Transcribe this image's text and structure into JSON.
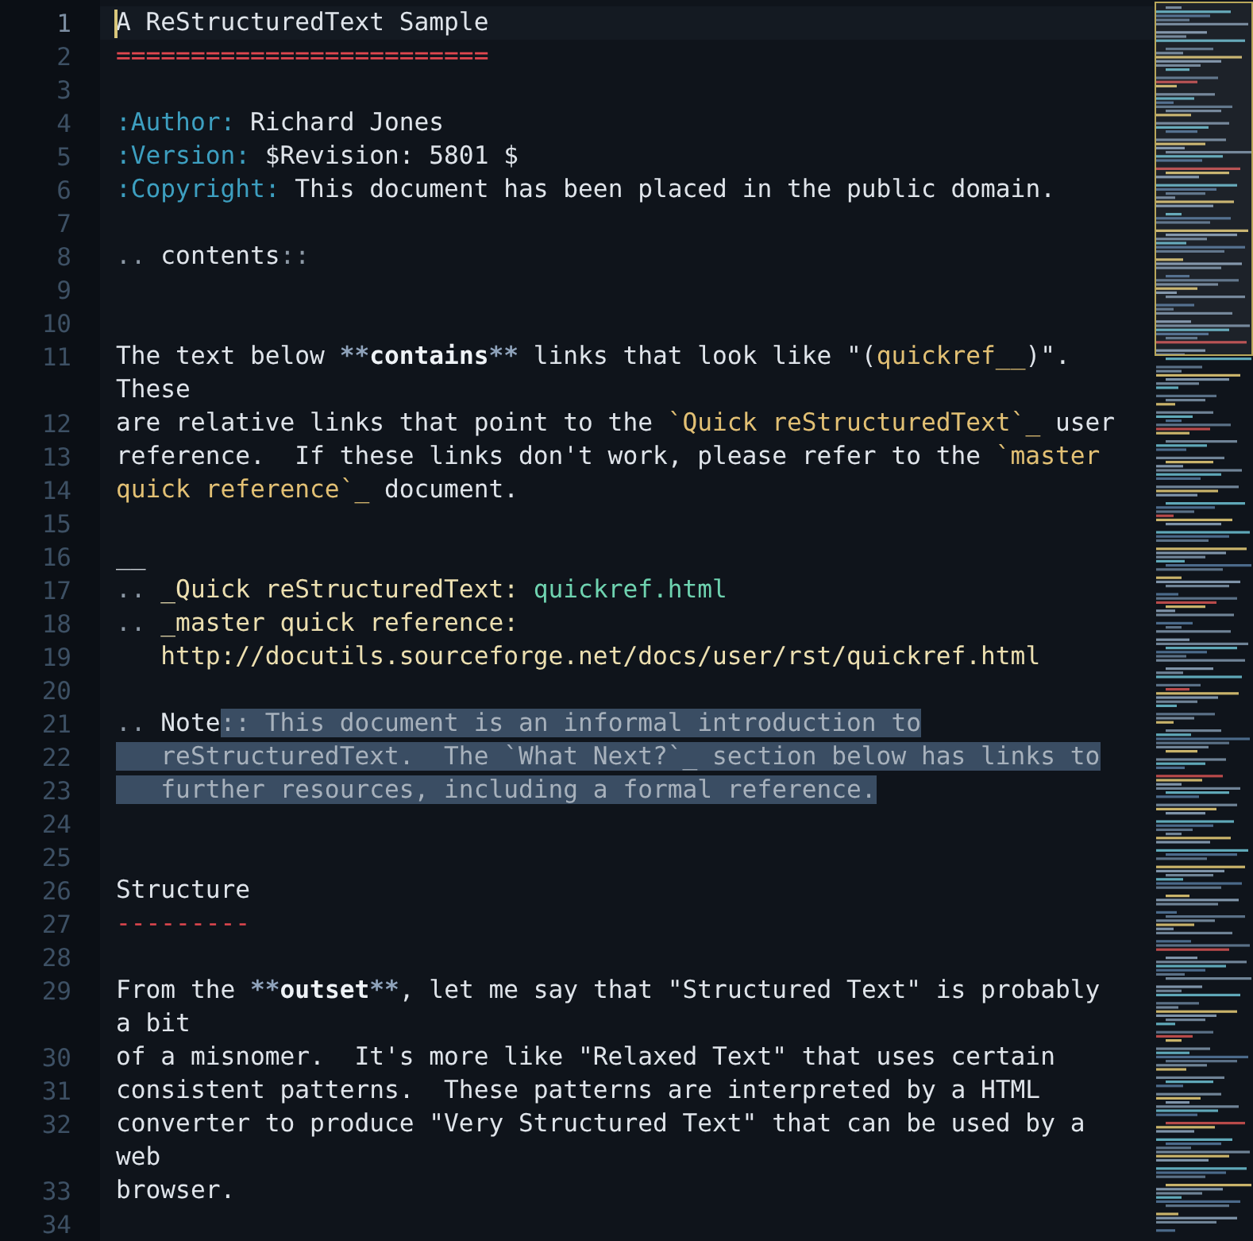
{
  "editor": {
    "lines": [
      {
        "number": "1",
        "current": true,
        "rows": [
          [
            {
              "kind": "plain",
              "text": "A ReStructuredText Sample"
            }
          ]
        ]
      },
      {
        "number": "2",
        "rows": [
          [
            {
              "kind": "underline",
              "text": "========================="
            }
          ]
        ]
      },
      {
        "number": "3",
        "rows": [
          []
        ]
      },
      {
        "number": "4",
        "rows": [
          [
            {
              "kind": "field",
              "text": ":Author:"
            },
            {
              "kind": "plain",
              "text": " Richard Jones"
            }
          ]
        ]
      },
      {
        "number": "5",
        "rows": [
          [
            {
              "kind": "field",
              "text": ":Version:"
            },
            {
              "kind": "plain",
              "text": " $Revision: 5801 $"
            }
          ]
        ]
      },
      {
        "number": "6",
        "rows": [
          [
            {
              "kind": "field",
              "text": ":Copyright:"
            },
            {
              "kind": "plain",
              "text": " This document has been placed in the public domain."
            }
          ]
        ]
      },
      {
        "number": "7",
        "rows": [
          []
        ]
      },
      {
        "number": "8",
        "rows": [
          [
            {
              "kind": "punct",
              "text": ".."
            },
            {
              "kind": "plain",
              "text": " contents"
            },
            {
              "kind": "punct",
              "text": "::"
            }
          ]
        ]
      },
      {
        "number": "9",
        "rows": [
          []
        ]
      },
      {
        "number": "10",
        "rows": [
          []
        ]
      },
      {
        "number": "11",
        "rows": [
          [
            {
              "kind": "plain",
              "text": "The text below "
            },
            {
              "kind": "marker",
              "text": "**"
            },
            {
              "kind": "strong",
              "text": "contains"
            },
            {
              "kind": "marker",
              "text": "**"
            },
            {
              "kind": "plain",
              "text": " links that look like \"("
            },
            {
              "kind": "ref",
              "text": "quickref__"
            },
            {
              "kind": "plain",
              "text": ")\"."
            }
          ],
          [
            {
              "kind": "plain",
              "text": "These"
            }
          ]
        ]
      },
      {
        "number": "12",
        "rows": [
          [
            {
              "kind": "plain",
              "text": "are relative links that point to the "
            },
            {
              "kind": "ref",
              "text": "`Quick reStructuredText`_"
            },
            {
              "kind": "plain",
              "text": " user"
            }
          ]
        ]
      },
      {
        "number": "13",
        "rows": [
          [
            {
              "kind": "plain",
              "text": "reference.  If these links don't work, please refer to the "
            },
            {
              "kind": "ref",
              "text": "`master"
            }
          ]
        ]
      },
      {
        "number": "14",
        "rows": [
          [
            {
              "kind": "ref",
              "text": "quick reference`_"
            },
            {
              "kind": "plain",
              "text": " document."
            }
          ]
        ]
      },
      {
        "number": "15",
        "rows": [
          []
        ]
      },
      {
        "number": "16",
        "rows": [
          [
            {
              "kind": "plain",
              "text": "__"
            }
          ]
        ]
      },
      {
        "number": "17",
        "rows": [
          [
            {
              "kind": "punct",
              "text": ".."
            },
            {
              "kind": "plain",
              "text": " "
            },
            {
              "kind": "target",
              "text": "_Quick reStructuredText:"
            },
            {
              "kind": "plain",
              "text": " "
            },
            {
              "kind": "url",
              "text": "quickref.html"
            }
          ]
        ]
      },
      {
        "number": "18",
        "rows": [
          [
            {
              "kind": "punct",
              "text": ".."
            },
            {
              "kind": "plain",
              "text": " "
            },
            {
              "kind": "target",
              "text": "_master quick reference:"
            }
          ]
        ]
      },
      {
        "number": "19",
        "rows": [
          [
            {
              "kind": "plain",
              "text": "   "
            },
            {
              "kind": "target",
              "text": "http://docutils.sourceforge.net/docs/user/rst/quickref.html"
            }
          ]
        ]
      },
      {
        "number": "20",
        "rows": [
          []
        ]
      },
      {
        "number": "21",
        "rows": [
          [
            {
              "kind": "punct",
              "text": ".."
            },
            {
              "kind": "plain",
              "text": " Note"
            },
            {
              "kind": "selected",
              "text": ":: This document is an informal introduction to"
            }
          ]
        ]
      },
      {
        "number": "22",
        "rows": [
          [
            {
              "kind": "selected",
              "text": "   reStructuredText.  The `What Next?`_ section below has links to"
            }
          ]
        ]
      },
      {
        "number": "23",
        "rows": [
          [
            {
              "kind": "selected",
              "text": "   further resources, including a formal reference."
            }
          ]
        ]
      },
      {
        "number": "24",
        "rows": [
          []
        ]
      },
      {
        "number": "25",
        "rows": [
          []
        ]
      },
      {
        "number": "26",
        "rows": [
          [
            {
              "kind": "plain",
              "text": "Structure"
            }
          ]
        ]
      },
      {
        "number": "27",
        "rows": [
          [
            {
              "kind": "underline",
              "text": "---------"
            }
          ]
        ]
      },
      {
        "number": "28",
        "rows": [
          []
        ]
      },
      {
        "number": "29",
        "rows": [
          [
            {
              "kind": "plain",
              "text": "From the "
            },
            {
              "kind": "marker",
              "text": "**"
            },
            {
              "kind": "strong",
              "text": "outset"
            },
            {
              "kind": "marker",
              "text": "**"
            },
            {
              "kind": "plain",
              "text": ", let me say that \"Structured Text\" is probably"
            }
          ],
          [
            {
              "kind": "plain",
              "text": "a bit"
            }
          ]
        ]
      },
      {
        "number": "30",
        "rows": [
          [
            {
              "kind": "plain",
              "text": "of a misnomer.  It's more like \"Relaxed Text\" that uses certain"
            }
          ]
        ]
      },
      {
        "number": "31",
        "rows": [
          [
            {
              "kind": "plain",
              "text": "consistent patterns.  These patterns are interpreted by a HTML"
            }
          ]
        ]
      },
      {
        "number": "32",
        "rows": [
          [
            {
              "kind": "plain",
              "text": "converter to produce \"Very Structured Text\" that can be used by a"
            }
          ],
          [
            {
              "kind": "plain",
              "text": "web"
            }
          ]
        ]
      },
      {
        "number": "33",
        "rows": [
          [
            {
              "kind": "plain",
              "text": "browser."
            }
          ]
        ]
      },
      {
        "number": "34",
        "rows": [
          []
        ]
      }
    ]
  }
}
